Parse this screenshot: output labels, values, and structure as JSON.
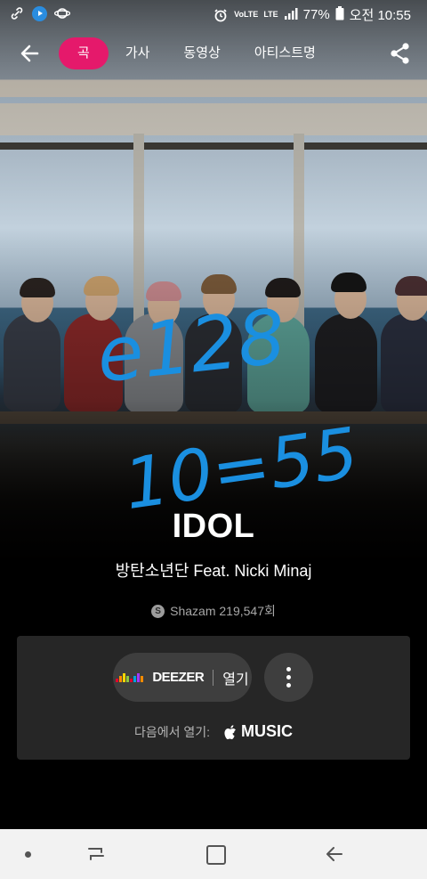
{
  "status_bar": {
    "volte": "VoLTE",
    "lte": "LTE",
    "battery": "77%",
    "time": "오전 10:55"
  },
  "nav": {
    "tabs": [
      {
        "label": "곡",
        "active": true
      },
      {
        "label": "가사",
        "active": false
      },
      {
        "label": "동영상",
        "active": false
      },
      {
        "label": "아티스트명",
        "active": false
      }
    ]
  },
  "song": {
    "title": "IDOL",
    "artist": "방탄소년단 Feat. Nicki Minaj",
    "shazam_count": "Shazam 219,547회"
  },
  "open_card": {
    "deezer_label": "DEEZER",
    "open_label": "열기",
    "open_in_label": "다음에서 열기:",
    "apple_music_label": "MUSIC"
  },
  "handwriting": {
    "line1": "e128",
    "line2": "10=55"
  },
  "colors": {
    "accent": "#e5196b",
    "card": "#262626",
    "button": "#3e3e3e",
    "ink": "#1a8fe0"
  }
}
